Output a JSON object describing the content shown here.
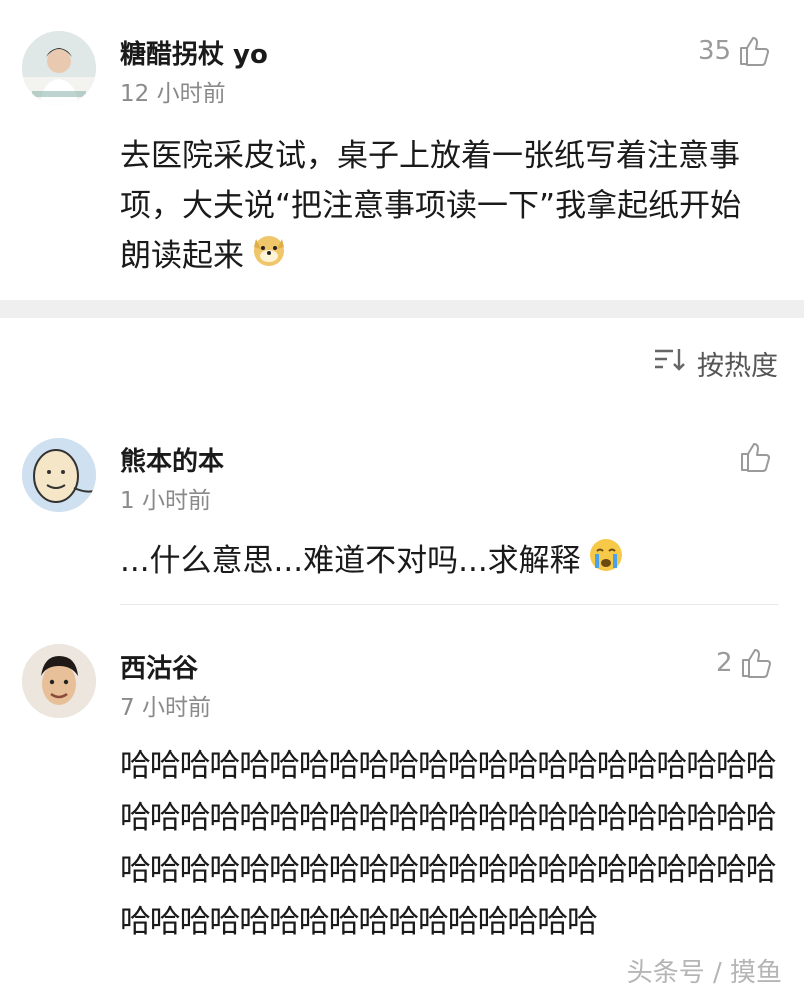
{
  "comments": [
    {
      "username": "糖醋拐杖 yo",
      "time": "12 小时前",
      "like_count": "35",
      "text": "去医院采皮试，桌子上放着一张纸写着注意事项，大夫说“把注意事项读一下”我拿起纸开始朗读起来",
      "emoji": "doge-emoji"
    },
    {
      "username": "熊本的本",
      "time": "1 小时前",
      "like_count": "",
      "text": "...什么意思...难道不对吗...求解释",
      "emoji": "crying-emoji"
    },
    {
      "username": "西沽谷",
      "time": "7 小时前",
      "like_count": "2",
      "text": "哈哈哈哈哈哈哈哈哈哈哈哈哈哈哈哈哈哈哈哈哈哈哈哈哈哈哈哈哈哈哈哈哈哈哈哈哈哈哈哈哈哈哈哈哈哈哈哈哈哈哈哈哈哈哈哈哈哈哈哈哈哈哈哈哈哈哈哈哈哈哈哈哈哈哈哈哈哈哈哈哈哈"
    }
  ],
  "sort": {
    "label": "按热度",
    "icon": "sort-icon"
  },
  "watermark": "头条号 / 摸鱼",
  "colors": {
    "gap": "#efefef",
    "muted": "#8a8a8a",
    "text": "#1a1a1a"
  }
}
